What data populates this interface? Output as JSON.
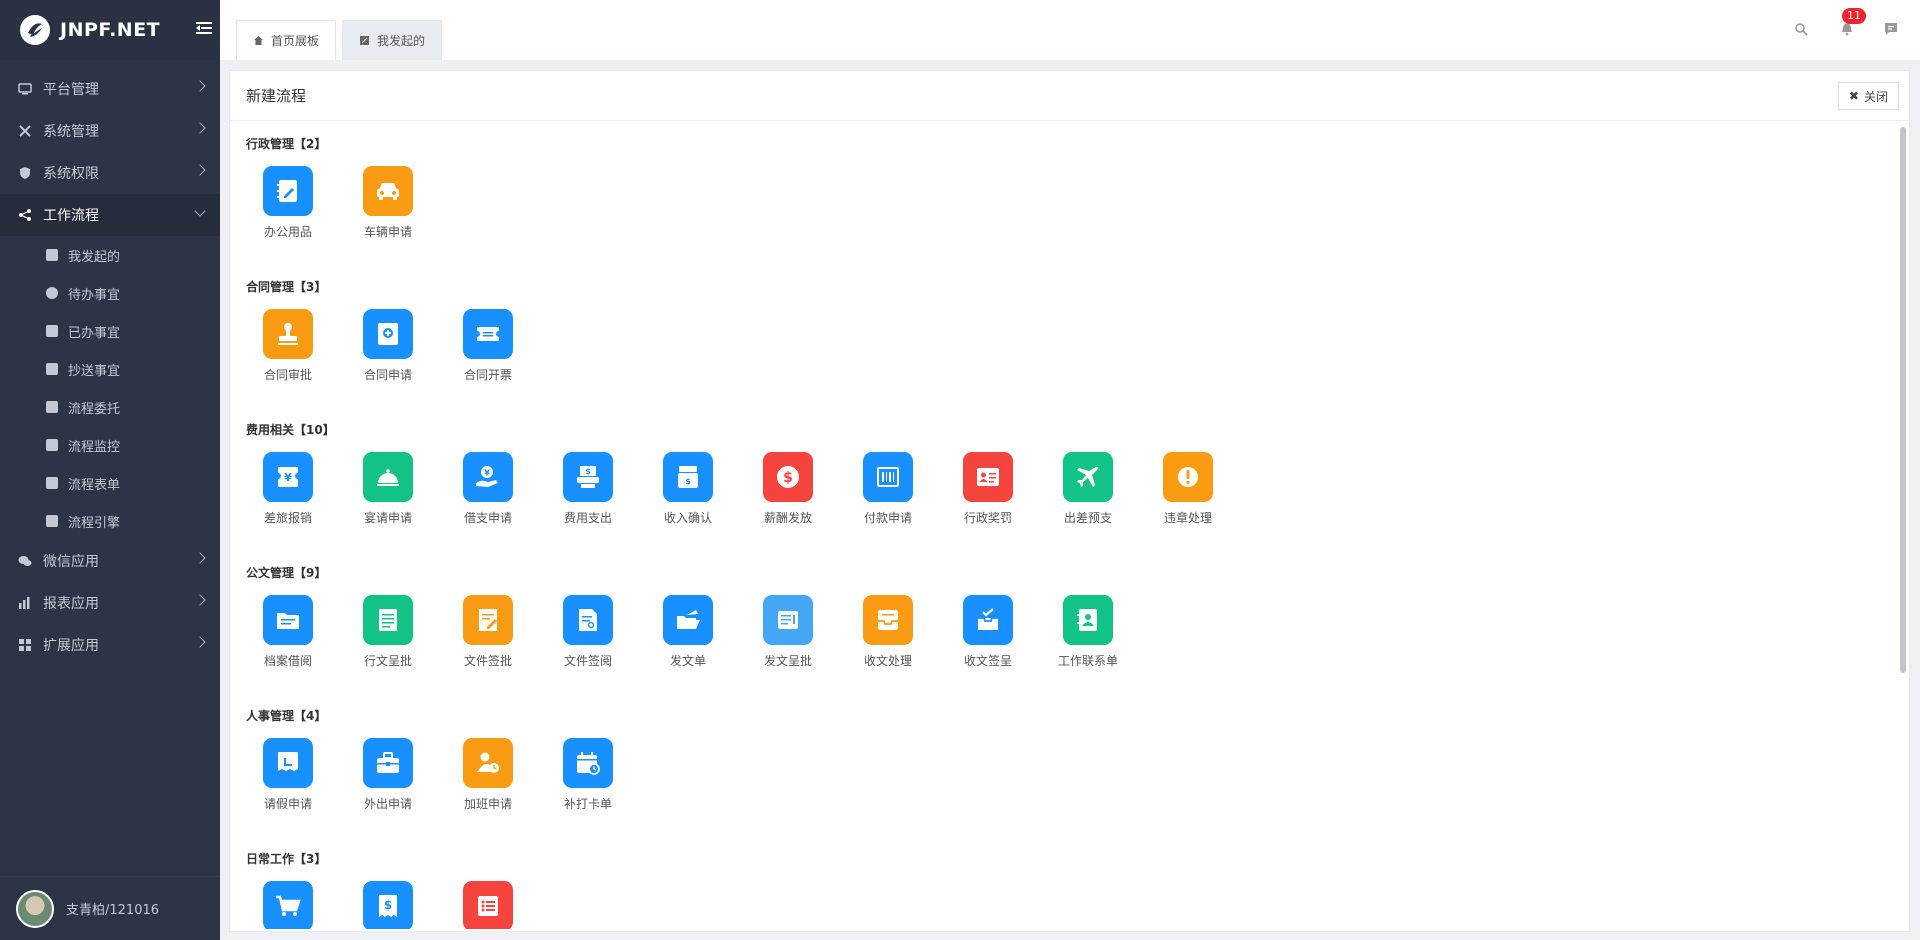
{
  "brand": {
    "name": "JNPF.NET"
  },
  "sidebar": {
    "items": [
      {
        "label": "平台管理",
        "icon": "monitor-icon",
        "active": false
      },
      {
        "label": "系统管理",
        "icon": "tools-icon",
        "active": false
      },
      {
        "label": "系统权限",
        "icon": "shield-icon",
        "active": false
      },
      {
        "label": "工作流程",
        "icon": "share-icon",
        "active": true
      },
      {
        "label": "微信应用",
        "icon": "wechat-icon",
        "active": false
      },
      {
        "label": "报表应用",
        "icon": "bar-chart-icon",
        "active": false
      },
      {
        "label": "扩展应用",
        "icon": "grid-icon",
        "active": false
      }
    ],
    "sub_items": [
      {
        "label": "我发起的",
        "icon": "edit-icon"
      },
      {
        "label": "待办事宜",
        "icon": "clock-icon"
      },
      {
        "label": "已办事宜",
        "icon": "user-icon"
      },
      {
        "label": "抄送事宜",
        "icon": "send-icon"
      },
      {
        "label": "流程委托",
        "icon": "hand-icon"
      },
      {
        "label": "流程监控",
        "icon": "monitor-icon"
      },
      {
        "label": "流程表单",
        "icon": "form-icon"
      },
      {
        "label": "流程引擎",
        "icon": "engine-icon"
      }
    ],
    "user": {
      "name": "支青柏/121016"
    }
  },
  "tabs": [
    {
      "label": "首页展板",
      "icon": "home-icon",
      "active": false
    },
    {
      "label": "我发起的",
      "icon": "edit-icon",
      "active": true
    }
  ],
  "header": {
    "notification_count": "11"
  },
  "panel": {
    "title": "新建流程",
    "close_label": "关闭"
  },
  "groups": [
    {
      "title": "行政管理【2】",
      "apps": [
        {
          "name": "办公用品",
          "color": "#1890ff",
          "icon": "notebook-icon"
        },
        {
          "name": "车辆申请",
          "color": "#fa9b14",
          "icon": "car-icon"
        }
      ]
    },
    {
      "title": "合同管理【3】",
      "apps": [
        {
          "name": "合同审批",
          "color": "#fa9b14",
          "icon": "stamp-icon"
        },
        {
          "name": "合同申请",
          "color": "#1890ff",
          "icon": "plus-doc-icon"
        },
        {
          "name": "合同开票",
          "color": "#1890ff",
          "icon": "ticket-icon"
        }
      ]
    },
    {
      "title": "费用相关【10】",
      "apps": [
        {
          "name": "差旅报销",
          "color": "#1890ff",
          "icon": "yen-ticket-icon"
        },
        {
          "name": "宴请申请",
          "color": "#12c287",
          "icon": "dish-icon"
        },
        {
          "name": "借支申请",
          "color": "#1890ff",
          "icon": "hand-coin-icon"
        },
        {
          "name": "费用支出",
          "color": "#1890ff",
          "icon": "dollar-printer-icon"
        },
        {
          "name": "收入确认",
          "color": "#1890ff",
          "icon": "dollar-box-icon"
        },
        {
          "name": "薪酬发放",
          "color": "#f5443e",
          "icon": "dollar-circle-icon"
        },
        {
          "name": "付款申请",
          "color": "#1890ff",
          "icon": "barcode-icon"
        },
        {
          "name": "行政奖罚",
          "color": "#f5443e",
          "icon": "id-card-icon"
        },
        {
          "name": "出差预支",
          "color": "#12c287",
          "icon": "plane-icon"
        },
        {
          "name": "违章处理",
          "color": "#fa9b14",
          "icon": "alert-icon"
        }
      ]
    },
    {
      "title": "公文管理【9】",
      "apps": [
        {
          "name": "档案借阅",
          "color": "#1890ff",
          "icon": "folder-icon"
        },
        {
          "name": "行文呈批",
          "color": "#12c287",
          "icon": "doc-list-icon"
        },
        {
          "name": "文件签批",
          "color": "#fa9b14",
          "icon": "doc-sign-icon"
        },
        {
          "name": "文件签阅",
          "color": "#1890ff",
          "icon": "doc-read-icon"
        },
        {
          "name": "发文单",
          "color": "#1890ff",
          "icon": "folder-open-icon"
        },
        {
          "name": "发文呈批",
          "color": "#45a6f5",
          "icon": "note-icon"
        },
        {
          "name": "收文处理",
          "color": "#fa9b14",
          "icon": "inbox-icon"
        },
        {
          "name": "收文签呈",
          "color": "#1890ff",
          "icon": "inbox-check-icon"
        },
        {
          "name": "工作联系单",
          "color": "#12c287",
          "icon": "contact-book-icon"
        }
      ]
    },
    {
      "title": "人事管理【4】",
      "apps": [
        {
          "name": "请假申请",
          "color": "#1890ff",
          "icon": "leave-icon"
        },
        {
          "name": "外出申请",
          "color": "#1890ff",
          "icon": "briefcase-icon"
        },
        {
          "name": "加班申请",
          "color": "#fa9b14",
          "icon": "user-clock-icon"
        },
        {
          "name": "补打卡单",
          "color": "#1890ff",
          "icon": "calendar-clock-icon"
        }
      ]
    },
    {
      "title": "日常工作【3】",
      "apps": [
        {
          "name": "",
          "color": "#1890ff",
          "icon": "cart-icon"
        },
        {
          "name": "",
          "color": "#1890ff",
          "icon": "dollar-receipt-icon"
        },
        {
          "name": "",
          "color": "#f5443e",
          "icon": "checklist-icon"
        }
      ]
    }
  ]
}
